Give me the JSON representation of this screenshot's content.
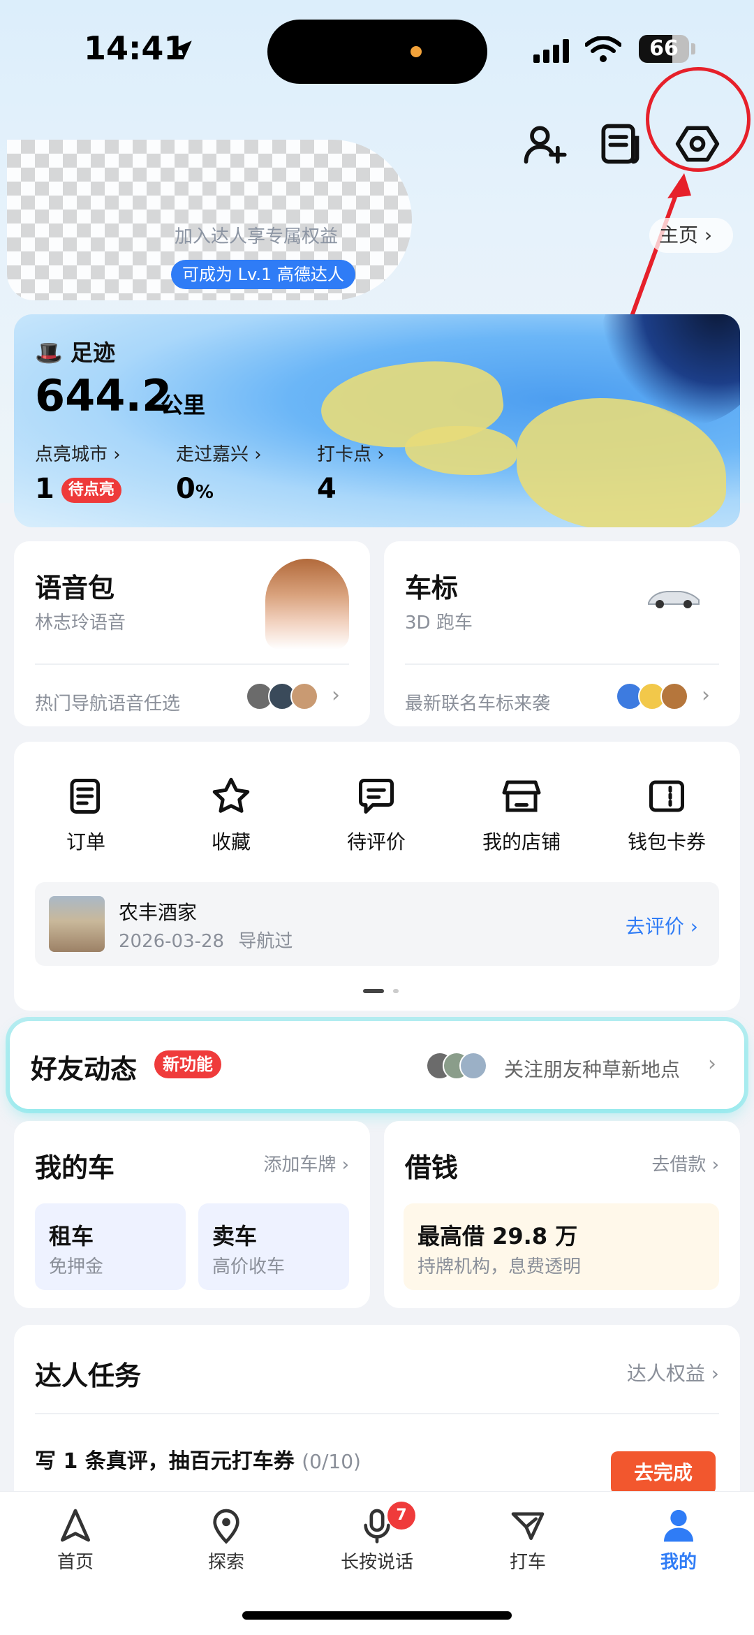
{
  "status_bar": {
    "time": "14:41",
    "battery": "66",
    "battery_level": 0.66
  },
  "header": {
    "add_friend_icon": "person-add-icon",
    "notes_icon": "notes-icon",
    "settings_icon": "hexagon-settings-icon"
  },
  "profile": {
    "subtitle": "加入达人享专属权益",
    "level_badge": "可成为 Lv.1 高德达人",
    "home_link": "主页"
  },
  "footprint": {
    "title": "足迹",
    "distance": "644.2",
    "unit": "公里",
    "stats": [
      {
        "label": "点亮城市",
        "value": "1",
        "badge": "待点亮"
      },
      {
        "label": "走过嘉兴",
        "value": "0",
        "unit": "%"
      },
      {
        "label": "打卡点",
        "value": "4"
      }
    ]
  },
  "voice_card": {
    "title": "语音包",
    "subtitle": "林志玲语音",
    "footer": "热门导航语音任选"
  },
  "car_icon_card": {
    "title": "车标",
    "subtitle": "3D 跑车",
    "footer": "最新联名车标来袭"
  },
  "tools": [
    {
      "label": "订单",
      "icon": "order-icon"
    },
    {
      "label": "收藏",
      "icon": "star-icon"
    },
    {
      "label": "待评价",
      "icon": "comment-icon"
    },
    {
      "label": "我的店铺",
      "icon": "shop-icon"
    },
    {
      "label": "钱包卡券",
      "icon": "wallet-icon"
    }
  ],
  "pending_review": {
    "name": "农丰酒家",
    "date": "2026-03-28",
    "note": "导航过",
    "action": "去评价"
  },
  "friends": {
    "title": "好友动态",
    "badge": "新功能",
    "text": "关注朋友种草新地点"
  },
  "my_car": {
    "title": "我的车",
    "action": "添加车牌",
    "options": [
      {
        "title": "租车",
        "sub": "免押金"
      },
      {
        "title": "卖车",
        "sub": "高价收车"
      }
    ]
  },
  "loan": {
    "title": "借钱",
    "action": "去借款",
    "headline": "最高借 29.8 万",
    "sub": "持牌机构，息费透明"
  },
  "tasks": {
    "title": "达人任务",
    "action": "达人权益",
    "item": "写 1 条真评，抽百元打车券",
    "progress": "(0/10)",
    "button": "去完成"
  },
  "tab_bar": [
    {
      "label": "首页",
      "icon": "navigation-arrow-icon"
    },
    {
      "label": "探索",
      "icon": "map-pin-icon"
    },
    {
      "label": "长按说话",
      "icon": "microphone-icon",
      "badge": "7"
    },
    {
      "label": "打车",
      "icon": "taxi-icon"
    },
    {
      "label": "我的",
      "icon": "user-icon",
      "active": true
    }
  ],
  "colors": {
    "accent": "#2f7cf6",
    "alert": "#ef3b3b",
    "annotation": "#e6202a"
  }
}
